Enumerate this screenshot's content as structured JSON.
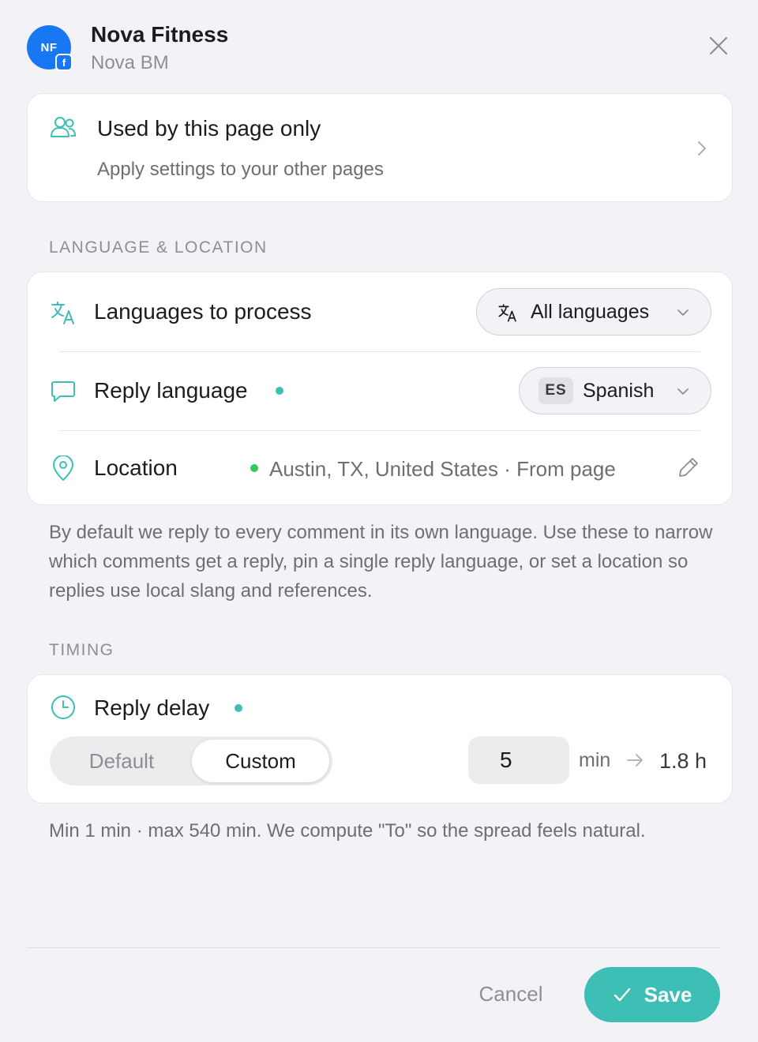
{
  "header": {
    "avatar_initials": "NF",
    "platform_badge": "f",
    "title": "Nova Fitness",
    "subtitle": "Nova BM"
  },
  "scope": {
    "title": "Used by this page only",
    "subtitle": "Apply settings to your other pages"
  },
  "language_section": {
    "label": "LANGUAGE & LOCATION",
    "languages_label": "Languages to process",
    "languages_value": "All languages",
    "reply_language_label": "Reply language",
    "reply_language_code": "ES",
    "reply_language_value": "Spanish",
    "location_label": "Location",
    "location_value": "Austin, TX, United States · From page",
    "description": "By default we reply to every comment in its own language. Use these to narrow which comments get a reply, pin a single reply language, or set a location so replies use local slang and references."
  },
  "timing_section": {
    "label": "TIMING",
    "reply_delay_label": "Reply delay",
    "mode_default": "Default",
    "mode_custom": "Custom",
    "selected_mode": "Custom",
    "delay_value": "5",
    "unit": "min",
    "to_value": "1.8 h",
    "description": "Min 1 min · max 540 min. We compute \"To\" so the spread feels natural."
  },
  "footer": {
    "cancel_label": "Cancel",
    "save_label": "Save"
  },
  "colors": {
    "accent": "#3dbfb6",
    "status_green": "#34c759",
    "facebook": "#1877f2"
  }
}
